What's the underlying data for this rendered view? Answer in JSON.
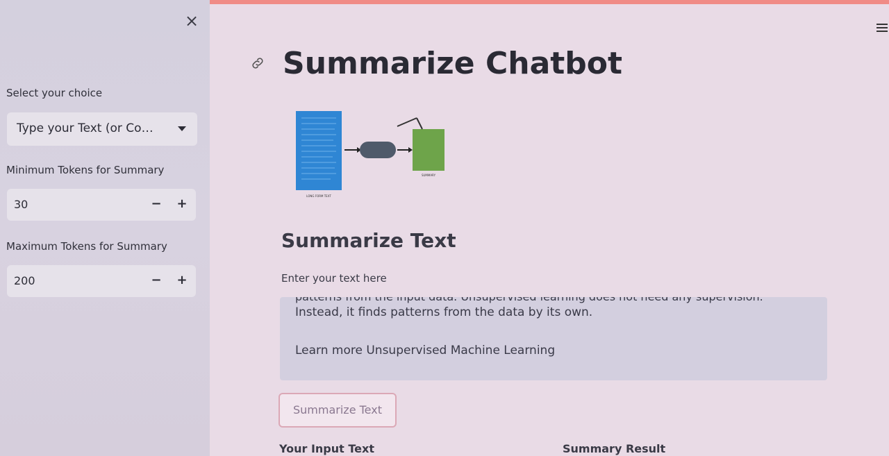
{
  "sidebar": {
    "choice_label": "Select your choice",
    "choice_value": "Type your Text (or Co…",
    "min_label": "Minimum Tokens for Summary",
    "min_value": "30",
    "max_label": "Maximum Tokens for Summary",
    "max_value": "200",
    "minus": "−",
    "plus": "+",
    "close": "×"
  },
  "main": {
    "title": "Summarize Chatbot",
    "subtitle": "Summarize Text",
    "input_label": "Enter your text here",
    "text_cut": "patterns from the input data. Unsupervised learning does not need any supervision.",
    "text_line1": "Instead, it finds patterns from the data by its own.",
    "text_line2": "Learn more Unsupervised Machine Learning",
    "button": "Summarize Text",
    "col_input": "Your Input Text",
    "col_result": "Summary Result"
  },
  "diagram": {
    "left_caption": "LONG FORM TEXT",
    "right_caption": "SUMMARY"
  },
  "colors": {
    "doc_blue": "#2f86d4",
    "summary_green": "#6ea44a",
    "pill": "#4f5a6a",
    "accent_red": "#f08b86"
  }
}
